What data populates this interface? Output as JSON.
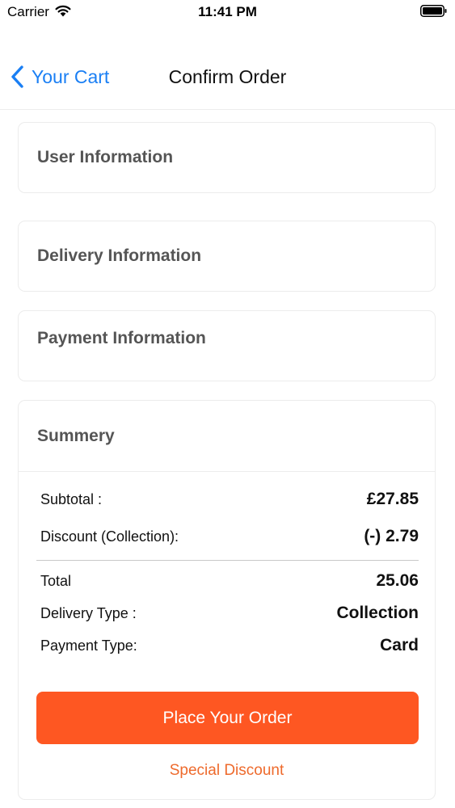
{
  "status_bar": {
    "carrier": "Carrier",
    "time": "11:41 PM",
    "wifi_icon": "wifi-icon",
    "battery_icon": "battery-full-icon"
  },
  "nav": {
    "back_label": "Your Cart",
    "back_icon": "chevron-left-icon",
    "title": "Confirm Order",
    "accent_color": "#1a7ff4"
  },
  "sections": {
    "user": "User Information",
    "delivery": "Delivery Information",
    "payment": "Payment Information",
    "summary": "Summery"
  },
  "summary": {
    "subtotal_label": "Subtotal :",
    "subtotal_value": "£27.85",
    "discount_label": "Discount (Collection):",
    "discount_value": "(-) 2.79",
    "total_label": "Total",
    "total_value": "25.06",
    "delivery_type_label": "Delivery Type :",
    "delivery_type_value": "Collection",
    "payment_type_label": "Payment Type:",
    "payment_type_value": "Card"
  },
  "actions": {
    "place_order_label": "Place Your Order",
    "place_order_color": "#fe5722",
    "special_discount_label": "Special Discount",
    "special_discount_color": "#ee6a2c"
  }
}
